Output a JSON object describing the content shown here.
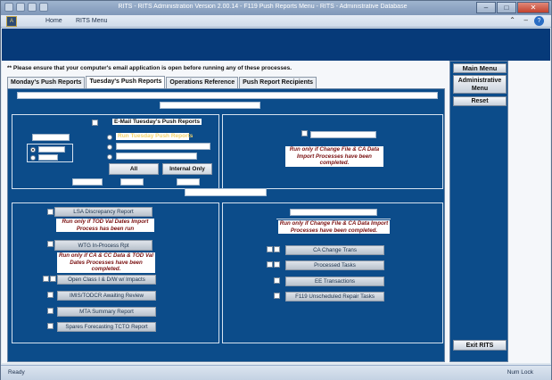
{
  "window": {
    "title": "RITS - RITS Administration Version 2.00.14 - F119 Push Reports Menu - RITS - Administrative Database",
    "minimize": "–",
    "restore": "□",
    "close": "✕"
  },
  "ribbon": {
    "tabs": [
      "Home",
      "RITS Menu"
    ],
    "help": "?"
  },
  "notice": "** Please ensure that your computer's email application is open before running any of these processes.",
  "tabs": [
    {
      "label": "Monday's Push Reports",
      "active": false
    },
    {
      "label": "Tuesday's Push Reports",
      "active": true
    },
    {
      "label": "Operations Reference",
      "active": false
    },
    {
      "label": "Push Report Recipients",
      "active": false
    }
  ],
  "top_left": {
    "email_label": "E-Mail Tuesday's Push Reports",
    "option_text": "Run Tuesday Push Reports",
    "all_button": "All",
    "internal_button": "Internal Only"
  },
  "top_right": {
    "warning": "Run only if Change File & CA Data Import Processes have been completed."
  },
  "bottom_left": {
    "items": [
      {
        "label": "LSA Discrepancy Report",
        "warning": "Run only if TOD Val Dates Import Process has been run"
      },
      {
        "label": "WTG In-Process Rpt",
        "warning": "Run only if CA & CC Data & TOD Val Dates Processes have been completed."
      },
      {
        "label": "Open Class I & D/W w/ Impacts"
      },
      {
        "label": "IMIS/TODCR Awaiting Review"
      },
      {
        "label": "MTA Summary Report"
      },
      {
        "label": "Spares Forecasting TCTO Report"
      }
    ]
  },
  "bottom_right": {
    "warning": "Run only if Change File & CA Data Import Processes have been completed.",
    "items": [
      "CA Change Trans",
      "Processed Tasks",
      "EE Transactions",
      "F119 Unscheduled Repair Tasks"
    ]
  },
  "side_menu": {
    "main_menu": "Main Menu",
    "admin_menu": "Administrative Menu",
    "reset": "Reset",
    "exit": "Exit RITS"
  },
  "status": {
    "left": "Ready",
    "right": "Num Lock"
  },
  "colors": {
    "panel": "#0c4c8a",
    "banner": "#063a79",
    "warning_text": "#7a1010",
    "highlight_text": "#f2d36b"
  }
}
